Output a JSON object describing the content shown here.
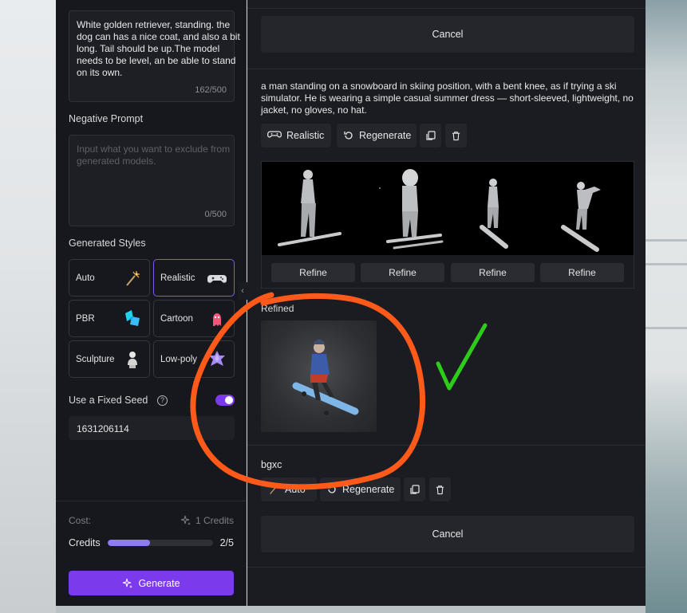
{
  "sidebar": {
    "prompt": {
      "text": "White golden retriever, standing. the dog can has a nice coat, and also a bit long. Tail should be up.The model needs to be level, an be able to stand on its own.",
      "counter": "162/500"
    },
    "negative_prompt": {
      "label": "Negative Prompt",
      "placeholder": "Input what you want to exclude from generated models.",
      "counter": "0/500"
    },
    "styles": {
      "label": "Generated Styles",
      "items": [
        {
          "label": "Auto",
          "icon": "magic-wand-icon"
        },
        {
          "label": "Realistic",
          "icon": "gamepad-icon",
          "selected": true
        },
        {
          "label": "PBR",
          "icon": "pbr-cube-icon"
        },
        {
          "label": "Cartoon",
          "icon": "cartoon-ghost-icon"
        },
        {
          "label": "Sculpture",
          "icon": "bust-icon"
        },
        {
          "label": "Low-poly",
          "icon": "lowpoly-gem-icon"
        }
      ]
    },
    "seed": {
      "label": "Use a Fixed Seed",
      "help": "?",
      "enabled": true,
      "value": "1631206114"
    },
    "cost": {
      "label": "Cost:",
      "value": "1 Credits"
    },
    "credits": {
      "label": "Credits",
      "count": "2/5",
      "fraction": 0.4
    },
    "generate_label": "Generate"
  },
  "collapse_glyph": "‹",
  "main": {
    "top_cancel": "Cancel",
    "job1": {
      "prompt": "a man standing on a snowboard in skiing position, with a bent knee, as if trying a ski simulator. He is wearing a simple casual summer dress — short-sleeved, lightweight, no jacket, no gloves, no hat.",
      "style_label": "Realistic",
      "regenerate_label": "Regenerate",
      "refine_labels": [
        "Refine",
        "Refine",
        "Refine",
        "Refine"
      ],
      "refined_label": "Refined"
    },
    "job2": {
      "title": "bgxc",
      "style_label": "Auto",
      "regenerate_label": "Regenerate",
      "cancel_label": "Cancel"
    }
  },
  "colors": {
    "accent": "#7c3aed",
    "annotation_orange": "#ff5a1a",
    "annotation_green": "#2ecc1a"
  }
}
